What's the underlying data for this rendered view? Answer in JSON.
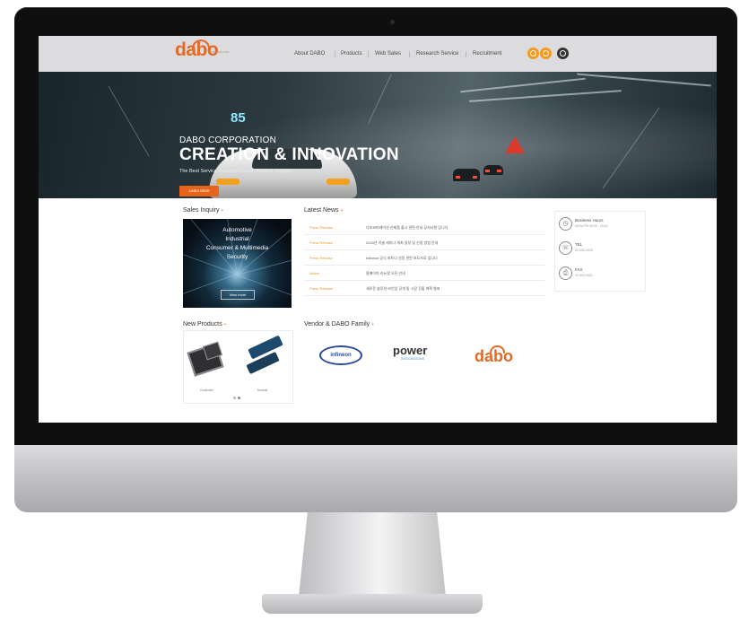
{
  "site": {
    "logo": "dabo",
    "logo_tag": "CORPORATION"
  },
  "nav": {
    "items": [
      "About DABO",
      "Products",
      "Web Sales",
      "Research Service",
      "Recruitment"
    ]
  },
  "hero": {
    "speed": "85",
    "eyebrow": "DABO CORPORATION",
    "title": "CREATION & INNOVATION",
    "subtitle": "The Best Service and High Quality Product Supplier",
    "button": "Learn More",
    "slides_total": 4,
    "slide_active": 1
  },
  "sales": {
    "title": "Sales Inquiry",
    "lines": [
      "Automotive",
      "Industrial",
      "Consumer & Multimedia",
      "Security"
    ],
    "button": "View more"
  },
  "news": {
    "title": "Latest News",
    "rows": [
      {
        "tag": "Press Release",
        "text": "다보코퍼레이션 신제품 출시 관련 안내 공지사항 입니다"
      },
      {
        "tag": "Press Release",
        "text": "2020년 기술 세미나 개최 일정 및 신청 방법 안내"
      },
      {
        "tag": "Press Release",
        "text": "Infineon 공식 파트너 선정 관련 보도자료 입니다"
      },
      {
        "tag": "Notice",
        "text": "홈페이지 리뉴얼 오픈 안내"
      },
      {
        "tag": "Press Release",
        "text": "새로운 솔루션 라인업 공개 및 시장 진출 계획 발표"
      }
    ]
  },
  "contact": {
    "items": [
      {
        "label": "Business Hours",
        "value": "MON-FRI 09:00 - 18:00"
      },
      {
        "label": "TEL",
        "value": "02-000-0000"
      },
      {
        "label": "FAX",
        "value": "02-000-0001"
      }
    ]
  },
  "products": {
    "title": "New Products",
    "captions": [
      "Controller",
      "Module"
    ]
  },
  "vendors": {
    "title": "Vendor & DABO Family",
    "items": [
      "infineon",
      "power",
      "dabo"
    ],
    "power_sub": "INTEGRATIONS"
  },
  "colors": {
    "brand": "#e26a24",
    "accent_orange": "#f39a1c",
    "nav_bg": "#dcdcde"
  }
}
